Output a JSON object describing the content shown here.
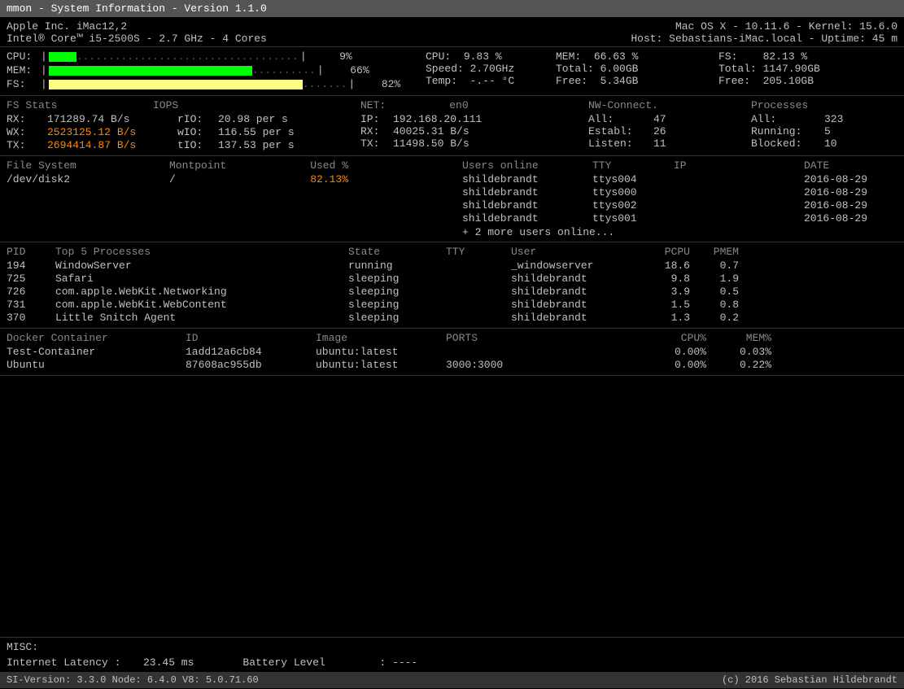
{
  "titleBar": {
    "title": "mmon - System Information - Version 1.1.0"
  },
  "topInfo": {
    "left": {
      "line1": "Apple Inc. iMac12,2",
      "line2": "Intel® Core™ i5-2500S - 2.7 GHz - 4 Cores"
    },
    "right": {
      "line1": "Mac OS X - 10.11.6 - Kernel: 15.6.0",
      "line2": "Host: Sebastians-iMac.local - Uptime: 45 m"
    }
  },
  "bars": {
    "cpu": {
      "label": "CPU:",
      "percent": 9,
      "display": "9%"
    },
    "mem": {
      "label": "MEM:",
      "percent": 66,
      "display": "66%"
    },
    "fs": {
      "label": "FS:",
      "percent": 82,
      "display": "82%"
    }
  },
  "statsRight": {
    "col1": [
      {
        "label": "CPU:",
        "value": "9.83 %"
      },
      {
        "label": "Speed:",
        "value": "2.70GHz"
      },
      {
        "label": "Temp:",
        "value": "-.-- °C"
      }
    ],
    "col2": [
      {
        "label": "MEM:",
        "value": "66.63 %"
      },
      {
        "label": "Total:",
        "value": "6.00GB"
      },
      {
        "label": "Free:",
        "value": "5.34GB"
      }
    ],
    "col3": [
      {
        "label": "FS:",
        "value": "82.13 %"
      },
      {
        "label": "Total:",
        "value": "1147.90GB"
      },
      {
        "label": "Free:",
        "value": "205.10GB"
      }
    ]
  },
  "fsStats": {
    "header1": "FS Stats",
    "header2": "IOPS",
    "rows": [
      {
        "label": "RX:",
        "value": "171289.74 B/s",
        "orange": false,
        "iopsLabel": "rIO:",
        "iopsValue": "20.98 per s"
      },
      {
        "label": "WX:",
        "value": "2523125.12 B/s",
        "orange": true,
        "iopsLabel": "wIO:",
        "iopsValue": "116.55 per s"
      },
      {
        "label": "TX:",
        "value": "2694414.87 B/s",
        "orange": true,
        "iopsLabel": "tIO:",
        "iopsValue": "137.53 per s"
      }
    ]
  },
  "net": {
    "header1": "NET:",
    "iface": "en0",
    "header2": "NW-Connect.",
    "header3": "Processes",
    "rows": [
      {
        "label": "IP:",
        "value": "192.168.20.111",
        "label2": "All:",
        "value2": "47",
        "label3": "All:",
        "value3": "323"
      },
      {
        "label": "RX:",
        "value": "40025.31 B/s",
        "label2": "Establ:",
        "value2": "26",
        "label3": "Running:",
        "value3": "5"
      },
      {
        "label": "TX:",
        "value": "11498.50 B/s",
        "label2": "Listen:",
        "value2": "11",
        "label3": "Blocked:",
        "value3": "10"
      }
    ]
  },
  "fileSystem": {
    "headers": [
      "File System",
      "Montpoint",
      "Used %"
    ],
    "rows": [
      {
        "fs": "/dev/disk2",
        "mount": "/",
        "used": "82.13%"
      }
    ]
  },
  "users": {
    "headers": [
      "Users online",
      "TTY",
      "IP",
      "DATE"
    ],
    "rows": [
      {
        "user": "shildebrandt",
        "tty": "ttys004",
        "ip": "",
        "date": "2016-08-29"
      },
      {
        "user": "shildebrandt",
        "tty": "ttys000",
        "ip": "",
        "date": "2016-08-29"
      },
      {
        "user": "shildebrandt",
        "tty": "ttys002",
        "ip": "",
        "date": "2016-08-29"
      },
      {
        "user": "shildebrandt",
        "tty": "ttys001",
        "ip": "",
        "date": "2016-08-29"
      }
    ],
    "moreText": "+ 2 more users online..."
  },
  "processes": {
    "headers": [
      "PID",
      "Top 5 Processes",
      "State",
      "TTY",
      "User",
      "PCPU",
      "PMEM"
    ],
    "rows": [
      {
        "pid": "194",
        "name": "WindowServer",
        "state": "running",
        "tty": "",
        "user": "_windowserver",
        "pcpu": "18.6",
        "pmem": "0.7"
      },
      {
        "pid": "725",
        "name": "Safari",
        "state": "sleeping",
        "tty": "",
        "user": "shildebrandt",
        "pcpu": "9.8",
        "pmem": "1.9"
      },
      {
        "pid": "726",
        "name": "com.apple.WebKit.Networking",
        "state": "sleeping",
        "tty": "",
        "user": "shildebrandt",
        "pcpu": "3.9",
        "pmem": "0.5"
      },
      {
        "pid": "731",
        "name": "com.apple.WebKit.WebContent",
        "state": "sleeping",
        "tty": "",
        "user": "shildebrandt",
        "pcpu": "1.5",
        "pmem": "0.8"
      },
      {
        "pid": "370",
        "name": "Little Snitch Agent",
        "state": "sleeping",
        "tty": "",
        "user": "shildebrandt",
        "pcpu": "1.3",
        "pmem": "0.2"
      }
    ]
  },
  "docker": {
    "headers": [
      "Docker Container",
      "ID",
      "Image",
      "PORTS",
      "CPU%",
      "MEM%"
    ],
    "rows": [
      {
        "name": "Test-Container",
        "id": "1add12a6cb84",
        "image": "ubuntu:latest",
        "ports": "",
        "cpu": "0.00%",
        "mem": "0.03%"
      },
      {
        "name": "Ubuntu",
        "id": "87608ac955db",
        "image": "ubuntu:latest",
        "ports": "3000:3000",
        "cpu": "0.00%",
        "mem": "0.22%"
      }
    ]
  },
  "misc": {
    "label": "MISC:",
    "items": [
      {
        "key": "Internet Latency :",
        "value": "23.45 ms"
      },
      {
        "key": "Battery Level",
        "value": ":   ----"
      }
    ]
  },
  "footer": {
    "left": "SI-Version: 3.3.0   Node: 6.4.0   V8: 5.0.71.60",
    "right": "(c) 2016 Sebastian Hildebrandt"
  }
}
